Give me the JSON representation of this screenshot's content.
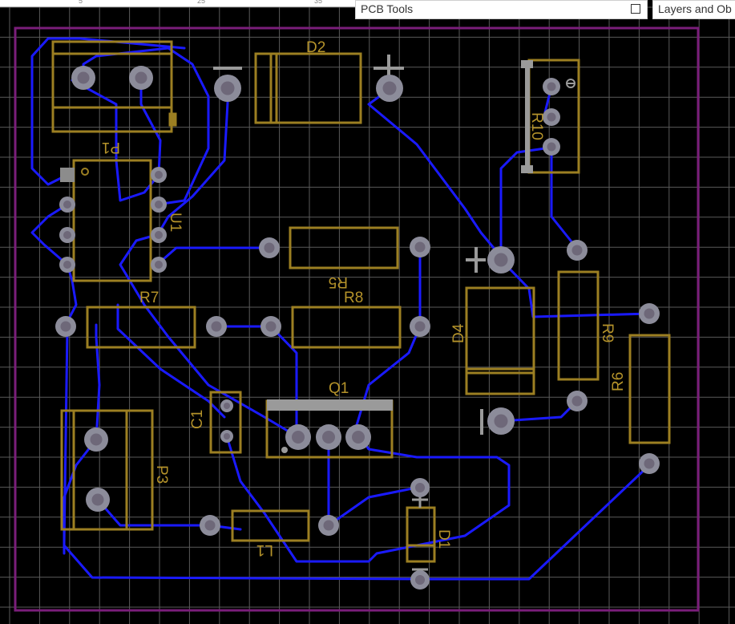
{
  "ruler": {
    "marks": [
      "5",
      "25",
      "35"
    ]
  },
  "panels": {
    "pcb_tools": {
      "title": "PCB Tools"
    },
    "layers": {
      "title": "Layers and Ob"
    }
  },
  "colors": {
    "background": "#000000",
    "grid": "#5a5a5a",
    "board_outline": "#7a1e7a",
    "trace": "#1a1aff",
    "silkscreen": "#9c7f22",
    "pad": "#8c8c9a",
    "pad_hole": "#4a3c52",
    "pad_square": "#8c8c8c",
    "marker": "#9a9a9a"
  },
  "components": {
    "P1": "P1",
    "D2": "D2",
    "R10": "R10",
    "U1": "U1",
    "R5": "R5",
    "R7": "R7",
    "R8": "R8",
    "D4": "D4",
    "R9": "R9",
    "R6": "R6",
    "Q1": "Q1",
    "C1": "C1",
    "P3": "P3",
    "L1": "L1",
    "D1": "D1"
  }
}
